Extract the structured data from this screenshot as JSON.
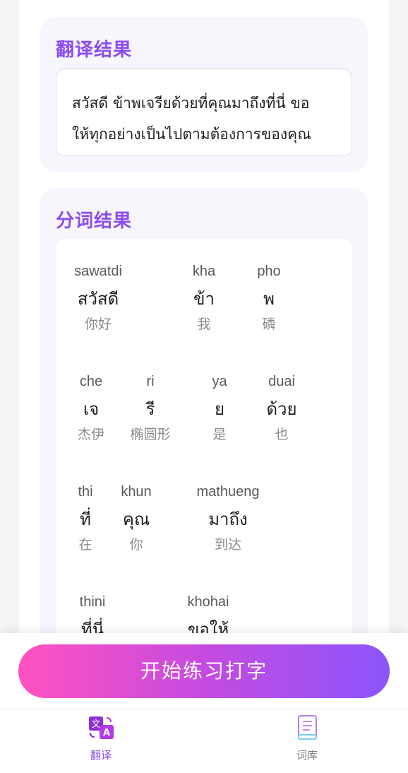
{
  "translate_card": {
    "title": "翻译结果",
    "text_line1": "สวัสดี ข้าพเจรียด้วยที่คุณมาถึงที่นี่ ขอ",
    "text_line2": "ให้ทุกอย่างเป็นไปตามต้องการของคุณ"
  },
  "segment_card": {
    "title": "分词结果",
    "words": [
      {
        "py": "sawatdi",
        "th": "สวัสดี",
        "zh": "你好"
      },
      {
        "py": "kha",
        "th": "ข้า",
        "zh": "我"
      },
      {
        "py": "pho",
        "th": "พ",
        "zh": "磷"
      },
      {
        "py": "che",
        "th": "เจ",
        "zh": "杰伊"
      },
      {
        "py": "ri",
        "th": "รี",
        "zh": "椭圆形"
      },
      {
        "py": "ya",
        "th": "ย",
        "zh": "是"
      },
      {
        "py": "duai",
        "th": "ด้วย",
        "zh": "也"
      },
      {
        "py": "thi",
        "th": "ที่",
        "zh": "在"
      },
      {
        "py": "khun",
        "th": "คุณ",
        "zh": "你"
      },
      {
        "py": "mathueng",
        "th": "มาถึง",
        "zh": "到达"
      },
      {
        "py": "thini",
        "th": "ที่นี่",
        "zh": ""
      },
      {
        "py": "khohai",
        "th": "ขอให้",
        "zh": ""
      }
    ]
  },
  "actions": {
    "start_label": "开始练习打字"
  },
  "tabbar": {
    "translate_label": "翻译",
    "library_label": "词库"
  },
  "colors": {
    "accent": "#8b4cf0",
    "gradient_start": "#ff52c0",
    "gradient_end": "#8b55fb"
  }
}
